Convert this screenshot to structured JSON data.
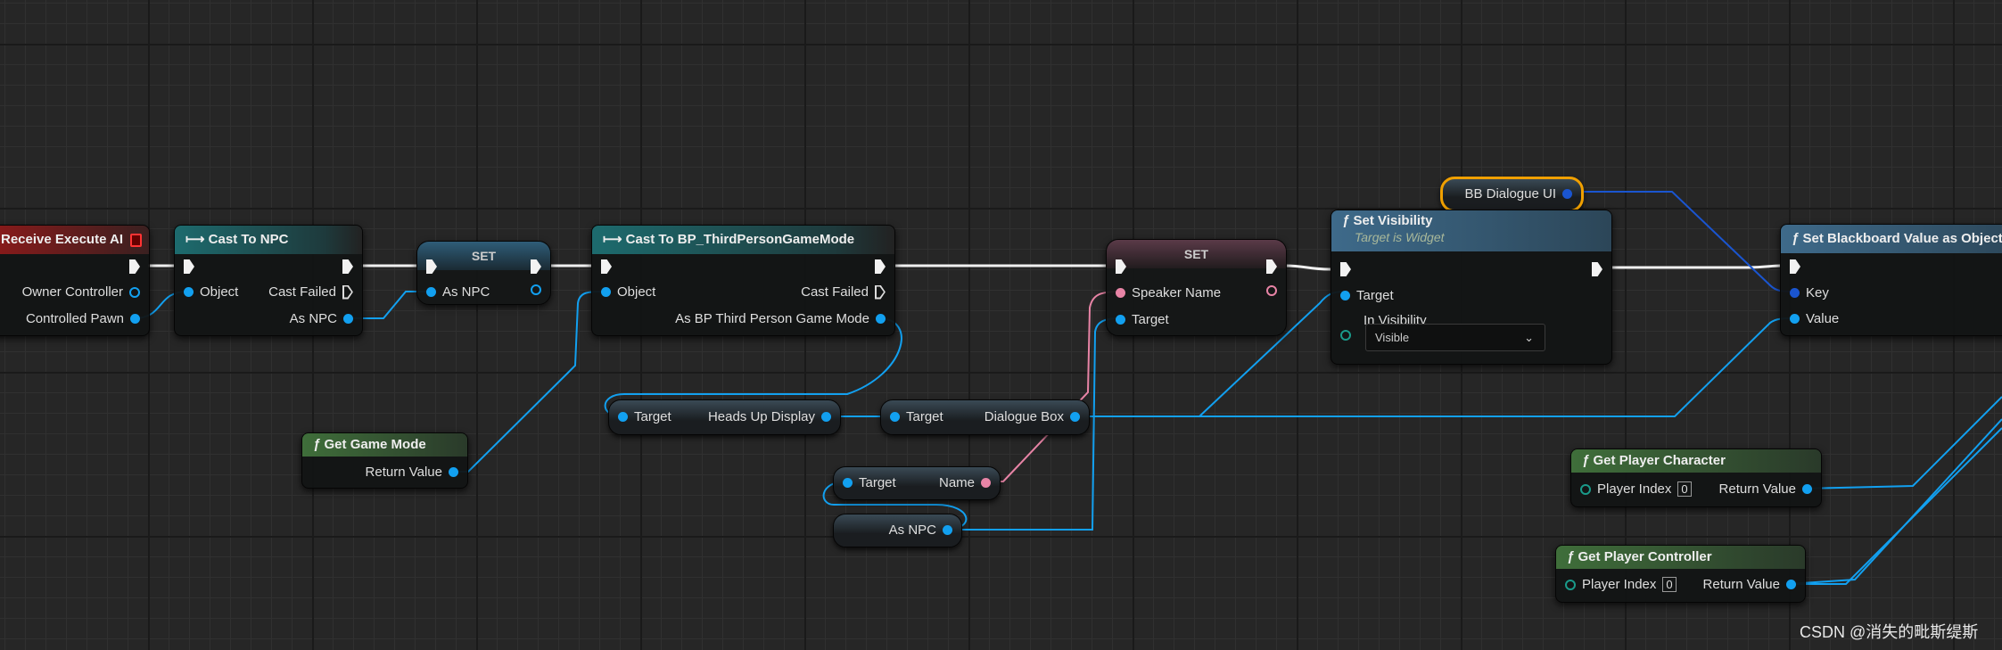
{
  "nodes": {
    "receive_execute_ai": {
      "title": "Receive Execute AI",
      "pins": [
        "Owner Controller",
        "Controlled Pawn"
      ]
    },
    "cast_to_npc": {
      "title": "Cast To NPC",
      "pins": [
        "Object",
        "Cast Failed",
        "As NPC"
      ]
    },
    "set_as_npc": {
      "title": "SET",
      "pins": [
        "As NPC"
      ]
    },
    "cast_to_gamemode": {
      "title": "Cast To BP_ThirdPersonGameMode",
      "pins": [
        "Object",
        "Cast Failed",
        "As BP Third Person Game Mode"
      ]
    },
    "get_game_mode": {
      "title": "Get Game Mode",
      "pins": [
        "Return Value"
      ]
    },
    "heads_up_display": {
      "pins": [
        "Target",
        "Heads Up Display"
      ]
    },
    "dialogue_box": {
      "pins": [
        "Target",
        "Dialogue Box"
      ]
    },
    "get_name": {
      "pins": [
        "Target",
        "Name"
      ]
    },
    "as_npc_var": {
      "pins": [
        "As NPC"
      ]
    },
    "set_speaker": {
      "title": "SET",
      "pins": [
        "Speaker Name",
        "Target"
      ]
    },
    "bb_dialogue_ui": {
      "pins": [
        "BB Dialogue UI"
      ]
    },
    "set_visibility": {
      "title": "Set Visibility",
      "subtitle": "Target is Widget",
      "pins": [
        "Target",
        "In Visibility"
      ],
      "visibility_value": "Visible"
    },
    "set_blackboard": {
      "title": "Set Blackboard Value as Object",
      "pins": [
        "Key",
        "Value"
      ]
    },
    "get_player_character": {
      "title": "Get Player Character",
      "pins": [
        "Player Index",
        "Return Value"
      ],
      "index": "0"
    },
    "get_player_controller": {
      "title": "Get Player Controller",
      "pins": [
        "Player Index",
        "Return Value"
      ],
      "index": "0"
    }
  },
  "watermark": "CSDN @消失的毗斯缇斯",
  "colors": {
    "object_pin": "#12a0f0",
    "string_pin": "#e884a6",
    "key_pin": "#1a55d0",
    "exec": "#f2f2f2",
    "selected_outline": "#f0a000"
  }
}
